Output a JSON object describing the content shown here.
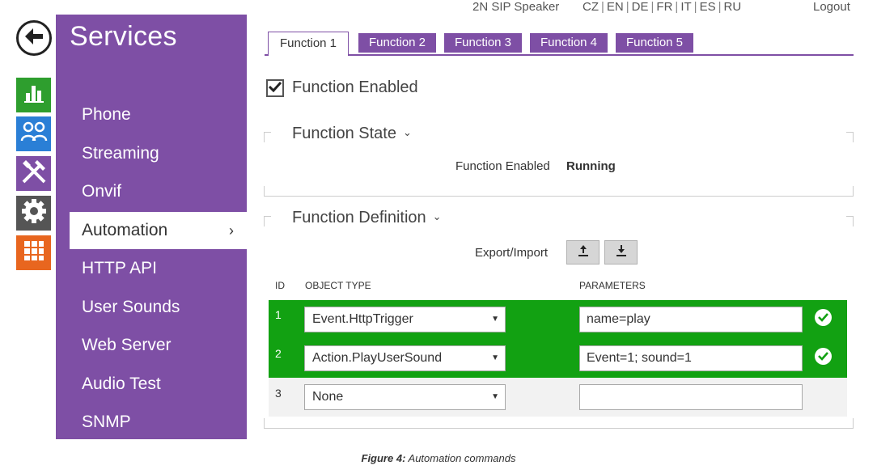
{
  "topbar": {
    "device_name": "2N SIP Speaker",
    "languages": [
      "CZ",
      "EN",
      "DE",
      "FR",
      "IT",
      "ES",
      "RU"
    ],
    "logout": "Logout"
  },
  "left_icons": [
    "back-arrow-icon",
    "status-chart-icon",
    "directory-users-icon",
    "hardware-tools-icon",
    "system-gear-icon",
    "apps-grid-icon"
  ],
  "sidebar": {
    "title": "Services",
    "items": [
      {
        "label": "Phone"
      },
      {
        "label": "Streaming"
      },
      {
        "label": "Onvif"
      },
      {
        "label": "Automation",
        "active": true
      },
      {
        "label": "HTTP API"
      },
      {
        "label": "User Sounds"
      },
      {
        "label": "Web Server"
      },
      {
        "label": "Audio Test"
      },
      {
        "label": "SNMP"
      }
    ]
  },
  "tabs": [
    {
      "label": "Function 1",
      "active": true
    },
    {
      "label": "Function 2"
    },
    {
      "label": "Function 3"
    },
    {
      "label": "Function 4"
    },
    {
      "label": "Function 5"
    }
  ],
  "function_enabled": {
    "label": "Function Enabled",
    "checked": true
  },
  "function_state": {
    "title": "Function State",
    "label": "Function Enabled",
    "value": "Running"
  },
  "function_definition": {
    "title": "Function Definition",
    "export_import_label": "Export/Import",
    "columns": {
      "id": "ID",
      "object_type": "OBJECT TYPE",
      "parameters": "PARAMETERS"
    },
    "rows": [
      {
        "id": "1",
        "object_type": "Event.HttpTrigger",
        "parameters": "name=play",
        "valid": true
      },
      {
        "id": "2",
        "object_type": "Action.PlayUserSound",
        "parameters": "Event=1; sound=1",
        "valid": true
      },
      {
        "id": "3",
        "object_type": "None",
        "parameters": "",
        "valid": false
      }
    ]
  },
  "caption": {
    "figure": "Figure 4:",
    "text": " Automation commands"
  },
  "colors": {
    "accent": "#7e4fa5",
    "row_ok": "#12a112",
    "status_tile": "#2e9e2e",
    "directory_tile": "#2a7fd6",
    "apps_tile": "#e8661f",
    "system_tile": "#555555"
  }
}
